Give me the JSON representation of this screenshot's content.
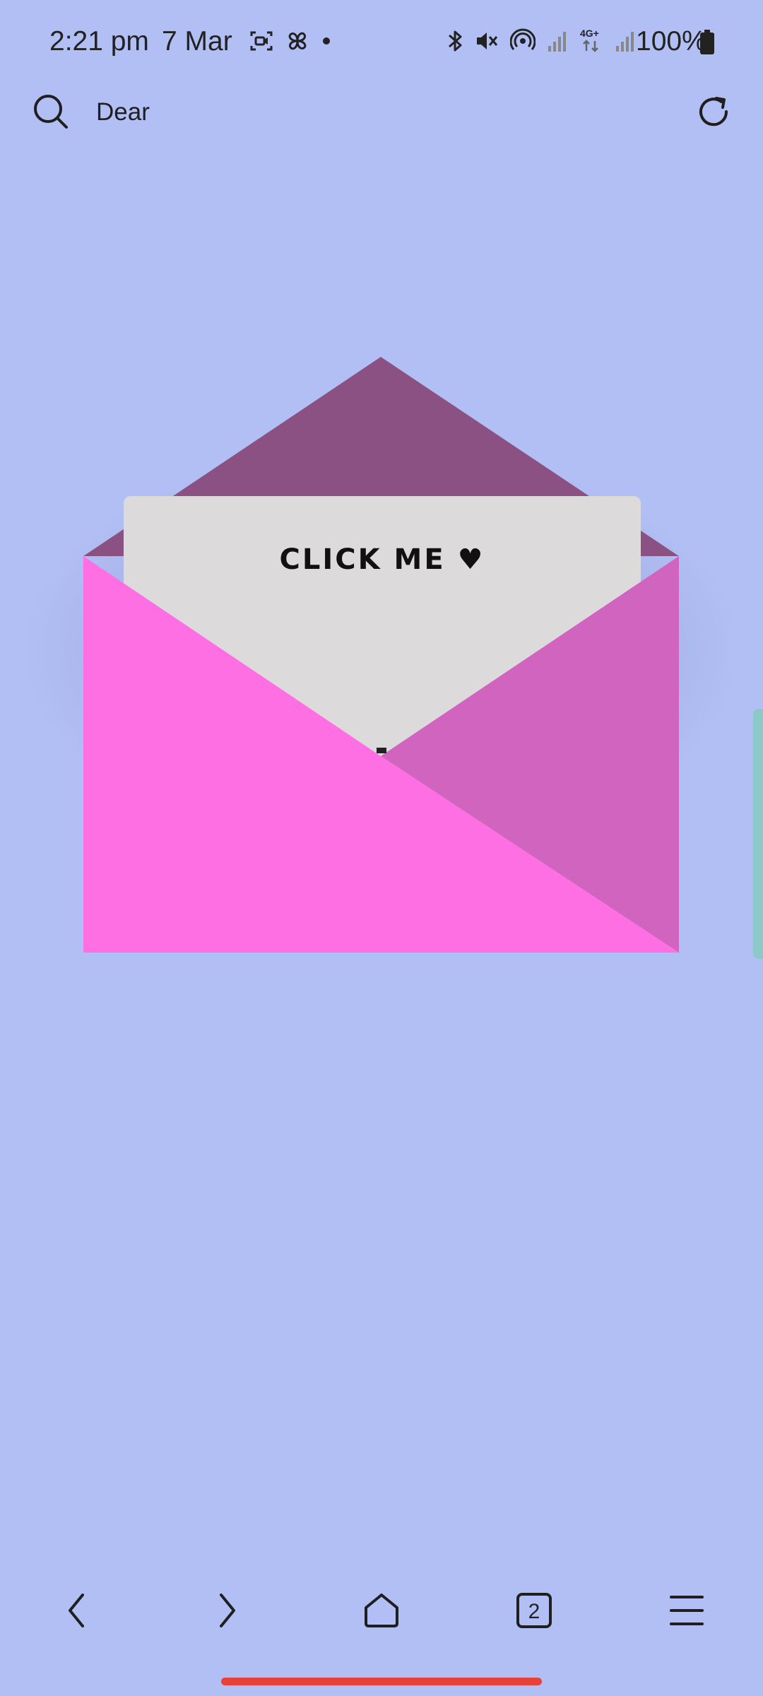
{
  "status_bar": {
    "time": "2:21 pm",
    "date": "7 Mar",
    "battery": "100%",
    "network": "4G+",
    "left_icons": [
      "screen-record-icon",
      "pinwheel-icon",
      "notification-dot-icon"
    ],
    "right_icons": [
      "bluetooth-icon",
      "mute-vibrate-icon",
      "hotspot-icon",
      "signal-icon",
      "network-4g-icon",
      "signal-icon",
      "battery-icon"
    ]
  },
  "toolbar": {
    "title": "Dear",
    "search_icon": "search-icon",
    "reload_icon": "reload-icon"
  },
  "letter": {
    "label": "CLICK ME ♥"
  },
  "colors": {
    "background": "#b1bff4",
    "envelope_flap": "#8b5183",
    "envelope_left": "#ff6fe4",
    "envelope_right": "#d064bf",
    "letter": "#dcdadb",
    "home_indicator": "#e8403a"
  },
  "bottom_nav": {
    "back_icon": "back-icon",
    "forward_icon": "forward-icon",
    "home_icon": "home-icon",
    "tabs_count": "2",
    "menu_icon": "menu-icon"
  }
}
